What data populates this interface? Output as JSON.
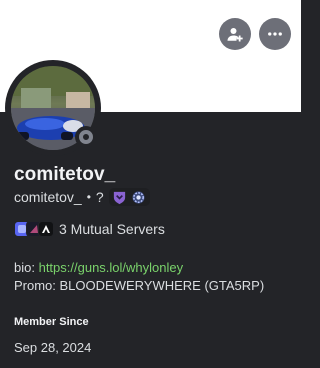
{
  "header": {
    "add_friend_icon": "add-friend-icon",
    "more_icon": "more-options-icon"
  },
  "profile": {
    "display_name": "comitetov_",
    "username": "comitetov_",
    "separator": "•",
    "pronoun_placeholder": "?",
    "status": "offline",
    "badges": [
      "nitro-shield-badge",
      "boost-badge"
    ],
    "mutual_servers_label": "3 Mutual Servers",
    "bio_label": "bio:",
    "bio_link": "https://guns.lol/whylonley",
    "promo_line": "Promo: BLOODEWERYWHERE (GTA5RP)",
    "member_since_title": "Member Since",
    "member_since_date": "Sep 28, 2024"
  },
  "colors": {
    "card_bg": "#232428",
    "banner": "#ffffff",
    "link": "#7ad26b",
    "nitro_badge": "#8a63d2"
  }
}
